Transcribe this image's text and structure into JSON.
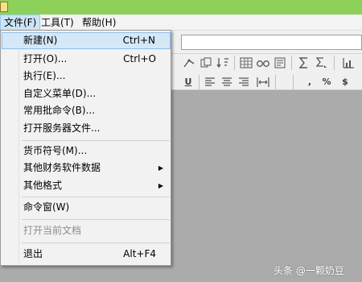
{
  "menubar": {
    "items": [
      {
        "label": "文件(F)"
      },
      {
        "label": "工具(T)"
      },
      {
        "label": "帮助(H)"
      }
    ]
  },
  "file_menu": {
    "items": [
      {
        "label": "新建(N)",
        "shortcut": "Ctrl+N"
      },
      {
        "label": "打开(O)...",
        "shortcut": "Ctrl+O"
      },
      {
        "label": "执行(E)..."
      },
      {
        "label": "自定义菜单(D)..."
      },
      {
        "label": "常用批命令(B)..."
      },
      {
        "label": "打开服务器文件..."
      },
      {
        "label": "货币符号(M)..."
      },
      {
        "label": "其他财务软件数据",
        "submenu": true
      },
      {
        "label": "其他格式",
        "submenu": true
      },
      {
        "label": "命令窗(W)"
      },
      {
        "label": "打开当前文档",
        "disabled": true
      },
      {
        "label": "退出",
        "shortcut": "Alt+F4"
      }
    ]
  },
  "toolbar": {
    "row1_icons": [
      "tree-icon",
      "copy-icon",
      "sort-icon",
      "table-icon",
      "find-icon",
      "format-icon",
      "sum-icon",
      "sum-menu-icon",
      "chart-icon"
    ],
    "row2_icons": [
      "underline-icon",
      "align-left-icon",
      "align-center-icon",
      "align-right-icon",
      "fit-width-icon",
      "comma-icon",
      "percent-icon",
      "currency-icon"
    ],
    "row2_glyphs": {
      "underline": "U",
      "comma": ",",
      "percent": "%",
      "currency": "$"
    }
  },
  "watermark": {
    "text": "头条 @一颗奶豆"
  },
  "colors": {
    "titlebar": "#8ed15a",
    "workspace": "#ababab",
    "highlight": "#d5e8f8"
  }
}
